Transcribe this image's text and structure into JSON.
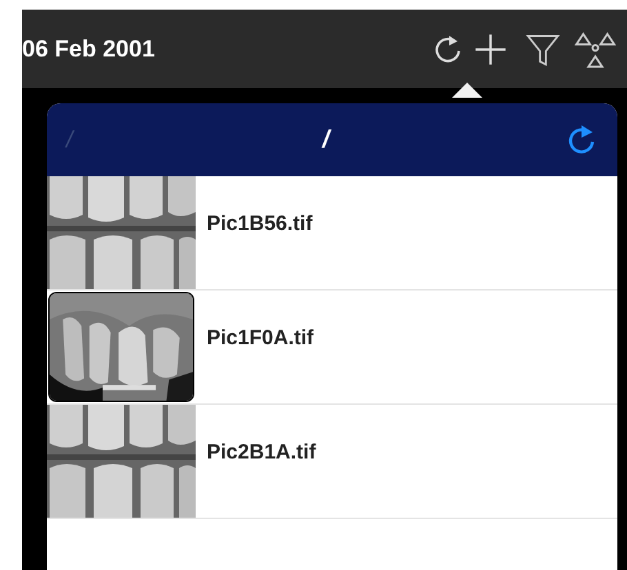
{
  "header": {
    "date": "06 Feb 2001"
  },
  "popover": {
    "nav": {
      "back_label": "/",
      "title": "/"
    },
    "files": [
      {
        "name": "Pic1B56.tif"
      },
      {
        "name": "Pic1F0A.tif"
      },
      {
        "name": "Pic2B1A.tif"
      }
    ]
  }
}
